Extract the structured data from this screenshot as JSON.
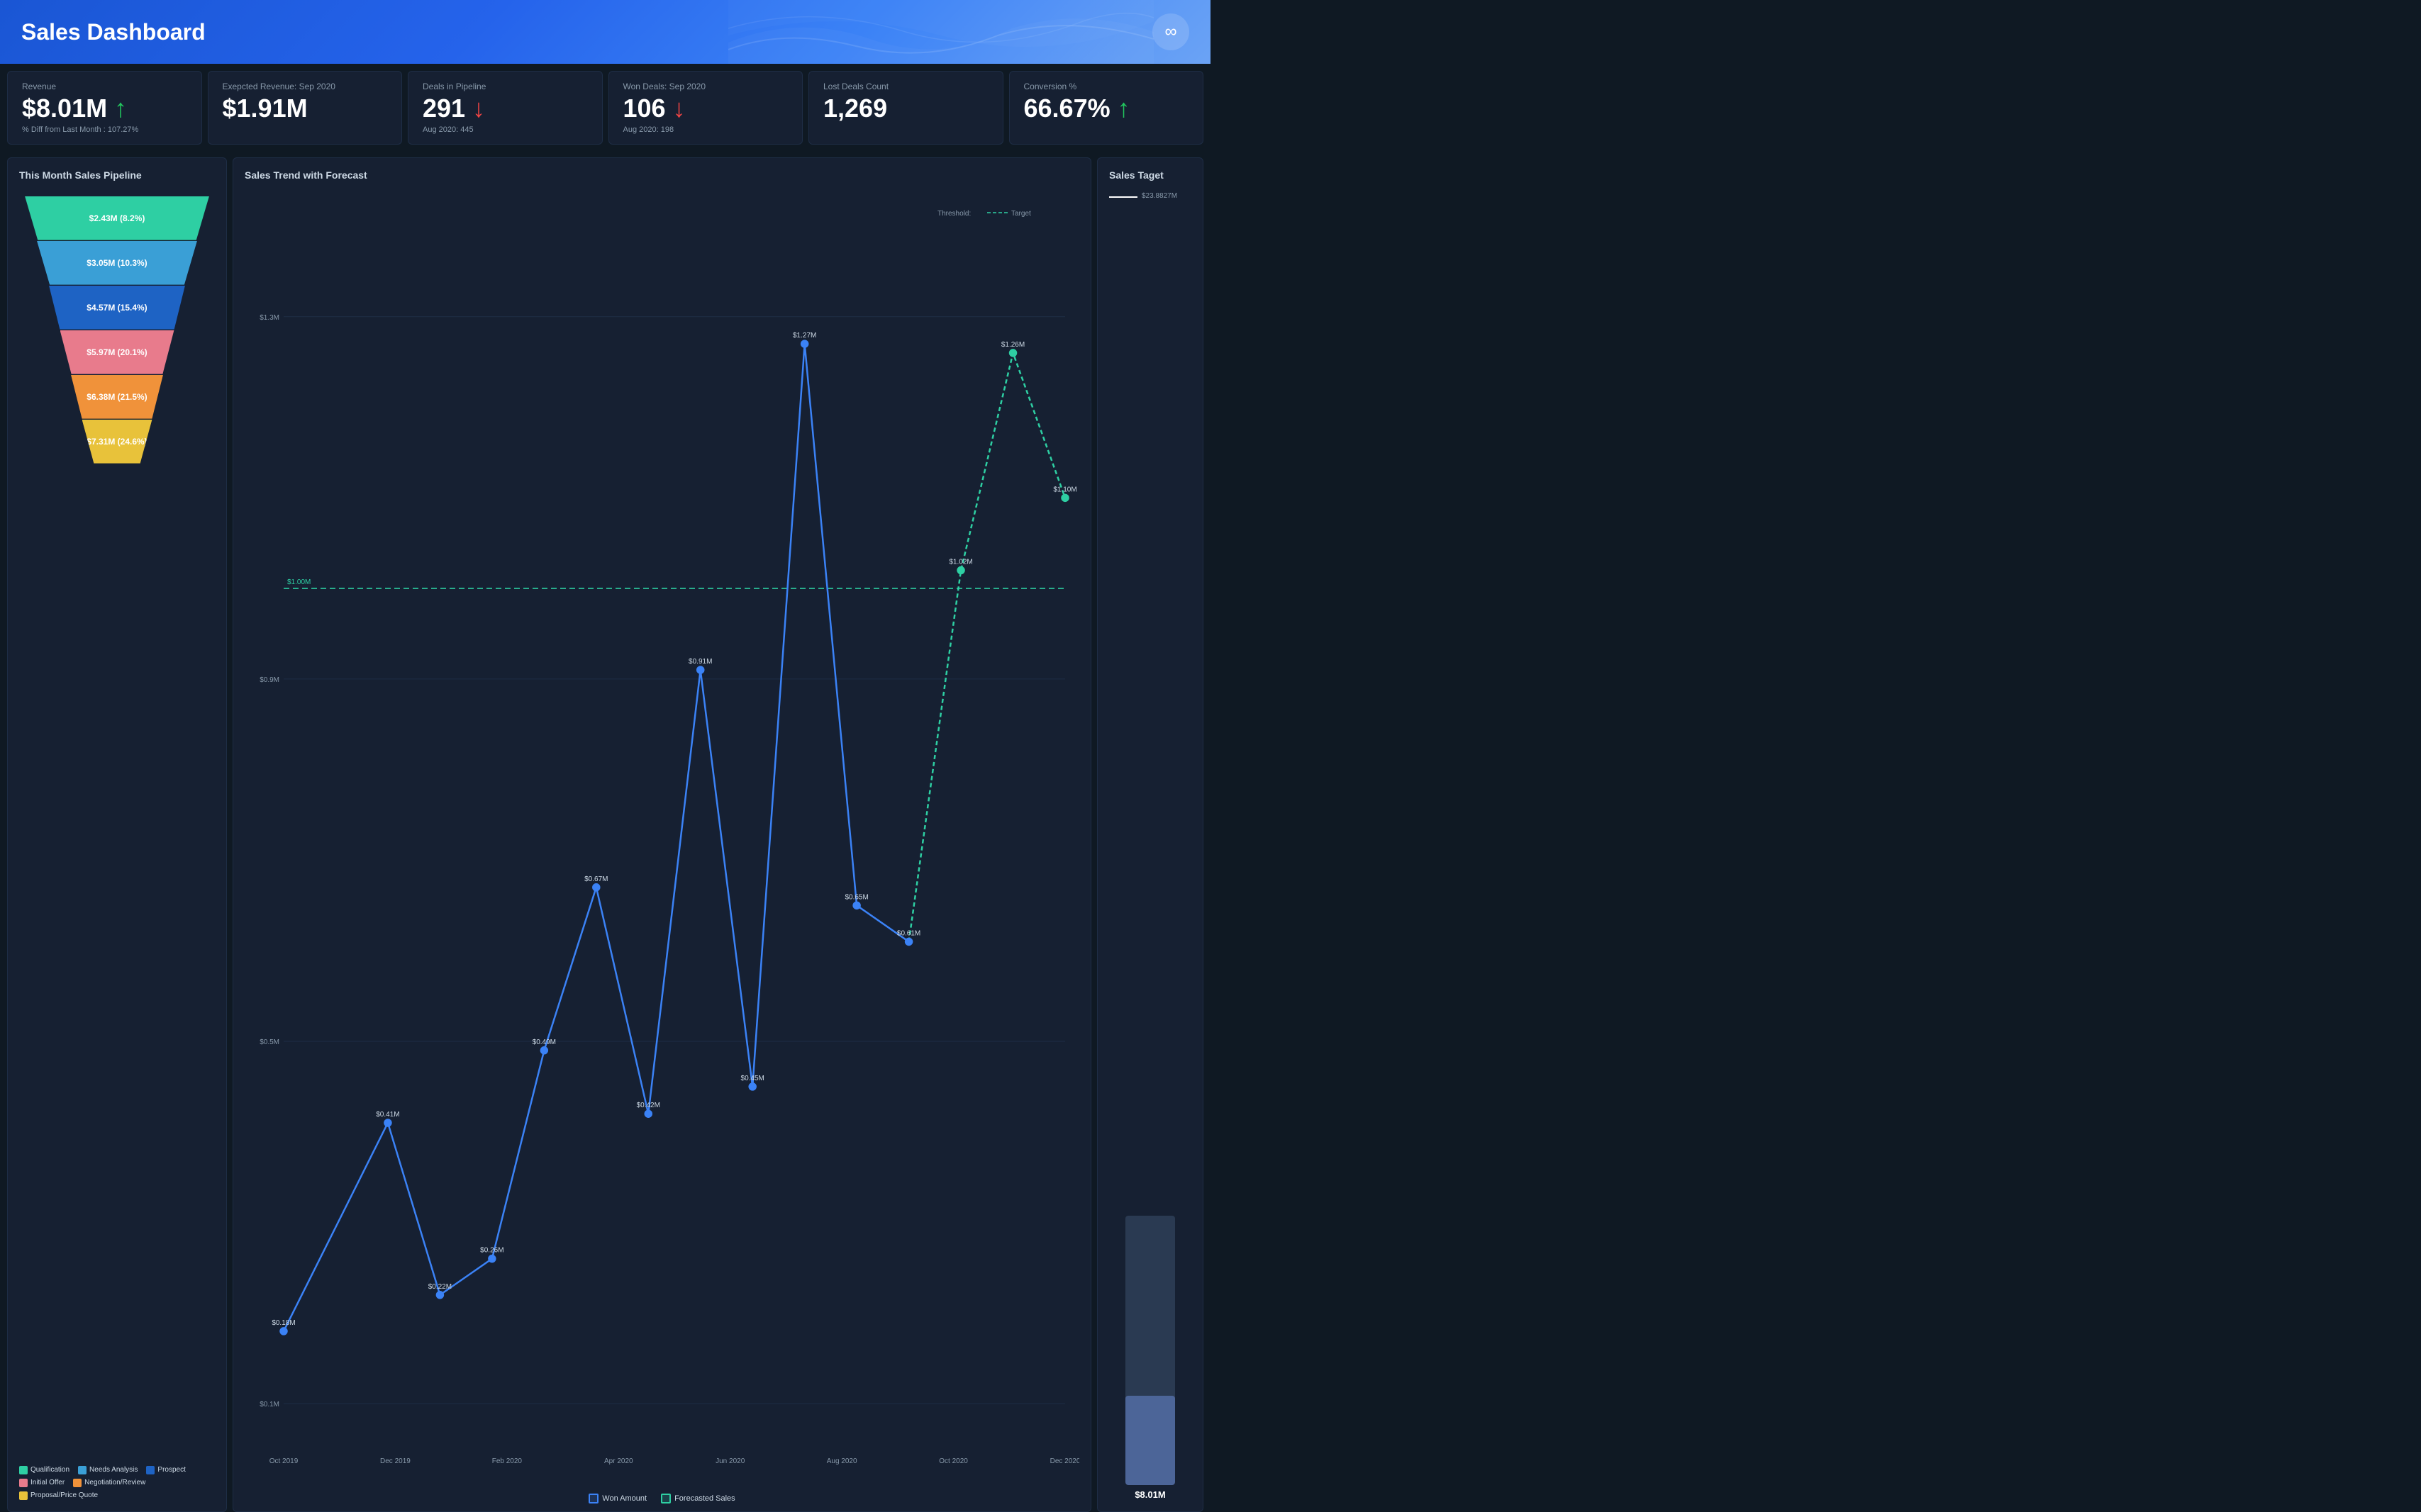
{
  "header": {
    "title": "Sales Dashboard",
    "logo_symbol": "∞"
  },
  "kpis": [
    {
      "id": "revenue",
      "label": "Revenue",
      "value": "$8.01M",
      "arrow": "up",
      "sub": "% Diff from Last Month : 107.27%"
    },
    {
      "id": "expected_revenue",
      "label": "Exepcted Revenue: Sep 2020",
      "value": "$1.91M",
      "arrow": null,
      "sub": ""
    },
    {
      "id": "deals_in_pipeline",
      "label": "Deals in Pipeline",
      "value": "291",
      "arrow": "down",
      "sub": "Aug 2020: 445"
    },
    {
      "id": "won_deals",
      "label": "Won Deals: Sep 2020",
      "value": "106",
      "arrow": "down",
      "sub": "Aug 2020: 198"
    },
    {
      "id": "lost_deals",
      "label": "Lost Deals Count",
      "value": "1,269",
      "arrow": null,
      "sub": ""
    },
    {
      "id": "conversion",
      "label": "Conversion %",
      "value": "66.67%",
      "arrow": "up",
      "sub": ""
    }
  ],
  "funnel": {
    "title": "This Month Sales Pipeline",
    "segments": [
      {
        "label": "$2.43M (8.2%)",
        "color": "#2ecfa3",
        "width_pct": 100,
        "height": 62
      },
      {
        "label": "$3.05M (10.3%)",
        "color": "#3a9fd6",
        "width_pct": 87,
        "height": 62
      },
      {
        "label": "$4.57M (15.4%)",
        "color": "#1e63c4",
        "width_pct": 74,
        "height": 62
      },
      {
        "label": "$5.97M (20.1%)",
        "color": "#e87b8c",
        "width_pct": 62,
        "height": 62
      },
      {
        "label": "$6.38M (21.5%)",
        "color": "#f0923a",
        "width_pct": 50,
        "height": 62
      },
      {
        "label": "$7.31M (24.6%)",
        "color": "#e8c23a",
        "width_pct": 38,
        "height": 62
      }
    ],
    "legend": [
      {
        "label": "Qualification",
        "color": "#2ecfa3"
      },
      {
        "label": "Needs Analysis",
        "color": "#3a9fd6"
      },
      {
        "label": "Prospect",
        "color": "#1e63c4"
      },
      {
        "label": "Initial Offer",
        "color": "#e87b8c"
      },
      {
        "label": "Negotiation/Review",
        "color": "#f0923a"
      },
      {
        "label": "Proposal/Price Quote",
        "color": "#e8c23a"
      }
    ]
  },
  "chart": {
    "title": "Sales Trend with Forecast",
    "threshold_label": "Threshold:",
    "target_label": "Target",
    "y_labels": [
      "$0.1M",
      "$0.5M",
      "$0.9M",
      "$1.3M"
    ],
    "x_labels": [
      "Oct 2019",
      "Dec 2019",
      "Feb 2020",
      "Apr 2020",
      "Jun 2020",
      "Aug 2020",
      "Oct 2020",
      "Dec 2020"
    ],
    "won_legend": "Won Amount",
    "forecast_legend": "Forecasted Sales",
    "data_points": [
      {
        "x": 0,
        "y": 0.18,
        "label": "$0.18M",
        "type": "won"
      },
      {
        "x": 1,
        "y": 0.41,
        "label": "$0.41M",
        "type": "won"
      },
      {
        "x": 1.5,
        "y": 0.22,
        "label": "$0.22M",
        "type": "won"
      },
      {
        "x": 2,
        "y": 0.26,
        "label": "$0.26M",
        "type": "won"
      },
      {
        "x": 2.5,
        "y": 0.49,
        "label": "$0.49M",
        "type": "won"
      },
      {
        "x": 3,
        "y": 0.67,
        "label": "$0.67M",
        "type": "won"
      },
      {
        "x": 3.5,
        "y": 0.42,
        "label": "$0.42M",
        "type": "won"
      },
      {
        "x": 4,
        "y": 0.91,
        "label": "$0.91M",
        "type": "won"
      },
      {
        "x": 4.5,
        "y": 0.45,
        "label": "$0.45M",
        "type": "won"
      },
      {
        "x": 5,
        "y": 1.27,
        "label": "$1.27M",
        "type": "won"
      },
      {
        "x": 5.5,
        "y": 0.65,
        "label": "$0.65M",
        "type": "won"
      },
      {
        "x": 6,
        "y": 0.61,
        "label": "$0.61M",
        "type": "won"
      },
      {
        "x": 6.5,
        "y": 1.02,
        "label": "$1.02M",
        "type": "forecast"
      },
      {
        "x": 7,
        "y": 1.26,
        "label": "$1.26M",
        "type": "forecast"
      },
      {
        "x": 7.5,
        "y": 1.1,
        "label": "$1.10M",
        "type": "forecast"
      }
    ],
    "threshold_value": 1.0,
    "threshold_label_value": "$1.00M"
  },
  "target": {
    "title": "Sales Taget",
    "target_value": "$23.8827M",
    "current_value": "$8.01M",
    "fill_pct": 33
  }
}
